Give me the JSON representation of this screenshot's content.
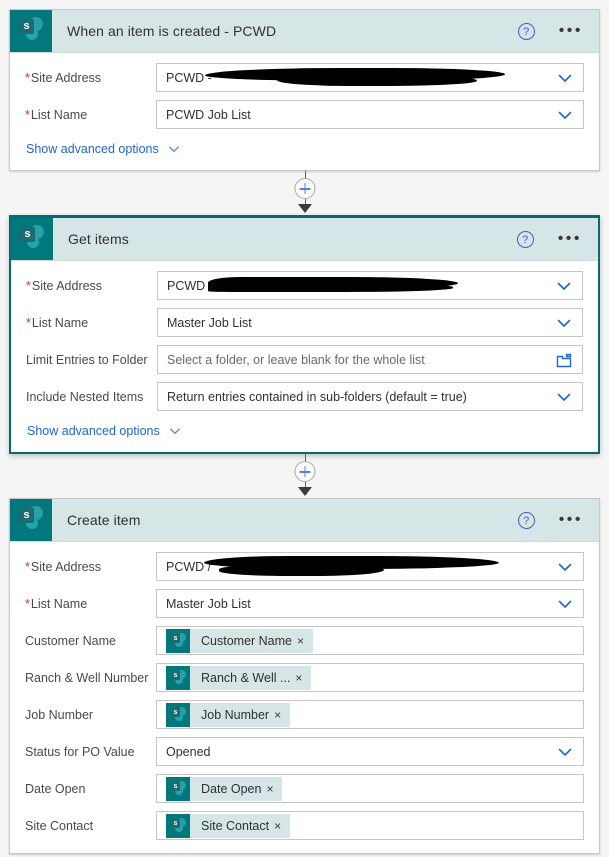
{
  "theme": {
    "accent_teal": "#036c70",
    "icon_tile": "#03787c",
    "header_band": "#d6e5e5",
    "link_blue": "#2266cc",
    "required_red": "#d13438",
    "page_background": "#f5f5f5"
  },
  "connector": {
    "add_label": "+",
    "add_name": "insert-new-step"
  },
  "cards": [
    {
      "id": "when-an-item-is-created",
      "title": "When an item is created - PCWD",
      "icon": "sharepoint-icon",
      "selected": false,
      "help_label": "?",
      "more_label": "•••",
      "advanced_label": "Show advanced options",
      "rows": [
        {
          "label": "Site Address",
          "required": true,
          "type": "dropdown",
          "value": "PCWD - ",
          "redacted": "a",
          "control": "chevron-down-icon"
        },
        {
          "label": "List Name",
          "required": true,
          "type": "dropdown",
          "value": "PCWD Job List",
          "control": "chevron-down-icon"
        }
      ]
    },
    {
      "id": "get-items",
      "title": "Get items",
      "icon": "sharepoint-icon",
      "selected": true,
      "help_label": "?",
      "more_label": "•••",
      "advanced_label": "Show advanced options",
      "rows": [
        {
          "label": "Site Address",
          "required": true,
          "type": "dropdown",
          "value": "PCWD / ",
          "redacted": "b",
          "control": "chevron-down-icon"
        },
        {
          "label": "List Name",
          "required": true,
          "type": "dropdown",
          "value": "Master Job List",
          "control": "chevron-down-icon"
        },
        {
          "label": "Limit Entries to Folder",
          "required": false,
          "type": "folder",
          "placeholder": "Select a folder, or leave blank for the whole list",
          "control": "folder-icon"
        },
        {
          "label": "Include Nested Items",
          "required": false,
          "type": "dropdown",
          "value": "Return entries contained in sub-folders (default = true)",
          "control": "chevron-down-icon"
        }
      ]
    },
    {
      "id": "create-item",
      "title": "Create item",
      "icon": "sharepoint-icon",
      "selected": false,
      "help_label": "?",
      "more_label": "•••",
      "rows": [
        {
          "label": "Site Address",
          "required": true,
          "type": "dropdown",
          "value": "PCWD /",
          "redacted": "c",
          "control": "chevron-down-icon"
        },
        {
          "label": "List Name",
          "required": true,
          "type": "dropdown",
          "value": "Master Job List",
          "control": "chevron-down-icon"
        },
        {
          "label": "Customer Name",
          "required": false,
          "type": "token",
          "token": "Customer Name",
          "token_remove": "×"
        },
        {
          "label": "Ranch & Well Number",
          "required": false,
          "type": "token",
          "token": "Ranch & Well ...",
          "token_remove": "×"
        },
        {
          "label": "Job Number",
          "required": false,
          "type": "token",
          "token": "Job Number",
          "token_remove": "×"
        },
        {
          "label": "Status for PO Value",
          "required": false,
          "type": "dropdown",
          "value": "Opened",
          "control": "chevron-down-icon"
        },
        {
          "label": "Date Open",
          "required": false,
          "type": "token",
          "token": "Date Open",
          "token_remove": "×"
        },
        {
          "label": "Site Contact",
          "required": false,
          "type": "token",
          "token": "Site Contact",
          "token_remove": "×"
        }
      ]
    }
  ]
}
